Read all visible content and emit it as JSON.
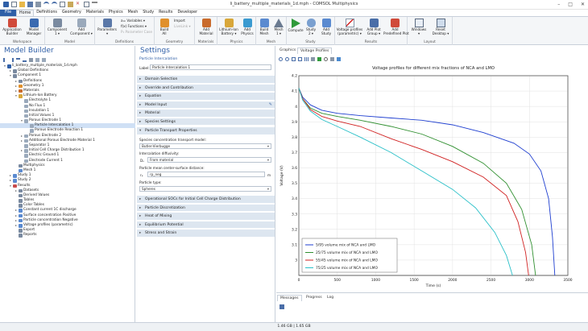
{
  "window": {
    "title": "li_battery_multiple_materials_1d.mph - COMSOL Multiphysics",
    "controls": [
      "–",
      "□",
      "✕"
    ]
  },
  "ribbon_tabs": [
    "File",
    "Home",
    "Definitions",
    "Geometry",
    "Materials",
    "Physics",
    "Mesh",
    "Study",
    "Results",
    "Developer"
  ],
  "ribbon": {
    "workspace": {
      "label": "Workspace",
      "app_builder": "Application\nBuilder",
      "model_manager": "Model\nManager"
    },
    "model": {
      "label": "Model",
      "component": "Component\n1 ▾",
      "add_component": "Add\nComponent ▾"
    },
    "definitions": {
      "label": "Definitions",
      "parameters": "Parameters\n▾",
      "variables": "a= Variables ▾",
      "functions": "f(x) Functions ▾",
      "param_case": "P₁ Parameter Case"
    },
    "geometry": {
      "label": "Geometry",
      "build_all": "Build\nAll",
      "import": "Import",
      "livelink": "LiveLink ▾"
    },
    "materials": {
      "label": "Materials",
      "add_material": "Add\nMaterial"
    },
    "physics": {
      "label": "Physics",
      "lib": "Lithium-Ion\nBattery ▾",
      "add_physics": "Add\nPhysics"
    },
    "mesh": {
      "label": "Mesh",
      "build_mesh": "Build\nMesh",
      "mesh1": "Mesh\n1 ▾"
    },
    "study": {
      "label": "Study",
      "compute": "Compute",
      "study2": "Study\n2 ▾",
      "add_study": "Add\nStudy"
    },
    "results": {
      "label": "Results",
      "voltage_profiles": "Voltage profiles\n(parametric) ▾",
      "add_plot_group": "Add Plot\nGroup ▾",
      "add_predefined": "Add\nPredefined Plot"
    },
    "layout": {
      "label": "Layout",
      "windows": "Windows\n▾",
      "reset_desktop": "Reset\nDesktop ▾"
    }
  },
  "model_builder": {
    "title": "Model Builder",
    "tree": [
      {
        "label": "li_battery_multiple_materials_1d.mph",
        "depth": 0,
        "tog": "▾",
        "color": "#2f5fa7"
      },
      {
        "label": "Global Definitions",
        "depth": 1,
        "tog": "▸",
        "color": "#7a8aa0"
      },
      {
        "label": "Component 1",
        "depth": 1,
        "tog": "▾",
        "color": "#7a8aa0"
      },
      {
        "label": "Definitions",
        "depth": 2,
        "tog": "▸",
        "color": "#7a8aa0"
      },
      {
        "label": "Geometry 1",
        "depth": 2,
        "tog": "▸",
        "color": "#e0902c"
      },
      {
        "label": "Materials",
        "depth": 2,
        "tog": "▸",
        "color": "#c96b2c"
      },
      {
        "label": "Lithium-Ion Battery",
        "depth": 2,
        "tog": "▾",
        "color": "#d8a73a"
      },
      {
        "label": "Electrolyte 1",
        "depth": 3,
        "tog": "",
        "color": "#9aa9bb"
      },
      {
        "label": "No Flux 1",
        "depth": 3,
        "tog": "",
        "color": "#9aa9bb"
      },
      {
        "label": "Insulation 1",
        "depth": 3,
        "tog": "",
        "color": "#9aa9bb"
      },
      {
        "label": "Initial Values 1",
        "depth": 3,
        "tog": "",
        "color": "#9aa9bb"
      },
      {
        "label": "Porous Electrode 1",
        "depth": 3,
        "tog": "▾",
        "color": "#9aa9bb"
      },
      {
        "label": "Particle Intercalation 1",
        "depth": 4,
        "tog": "",
        "color": "#9aa9bb",
        "selected": true
      },
      {
        "label": "Porous Electrode Reaction 1",
        "depth": 4,
        "tog": "",
        "color": "#9aa9bb"
      },
      {
        "label": "Porous Electrode 2",
        "depth": 3,
        "tog": "▸",
        "color": "#9aa9bb"
      },
      {
        "label": "Additional Porous Electrode Material 1",
        "depth": 3,
        "tog": "▸",
        "color": "#9aa9bb"
      },
      {
        "label": "Separator 1",
        "depth": 3,
        "tog": "",
        "color": "#9aa9bb"
      },
      {
        "label": "Initial Cell Charge Distribution 1",
        "depth": 3,
        "tog": "▸",
        "color": "#9aa9bb"
      },
      {
        "label": "Electric Ground 1",
        "depth": 3,
        "tog": "",
        "color": "#9aa9bb"
      },
      {
        "label": "Electrode Current 1",
        "depth": 3,
        "tog": "",
        "color": "#9aa9bb"
      },
      {
        "label": "Multiphysics",
        "depth": 2,
        "tog": "",
        "color": "#7a8aa0"
      },
      {
        "label": "Mesh 1",
        "depth": 2,
        "tog": "",
        "color": "#5a8ad0"
      },
      {
        "label": "Study 1",
        "depth": 1,
        "tog": "▸",
        "color": "#5a8ad0"
      },
      {
        "label": "Study 2",
        "depth": 1,
        "tog": "▸",
        "color": "#5a8ad0"
      },
      {
        "label": "Results",
        "depth": 1,
        "tog": "▾",
        "color": "#c94d4d"
      },
      {
        "label": "Datasets",
        "depth": 2,
        "tog": "▸",
        "color": "#7a8aa0"
      },
      {
        "label": "Derived Values",
        "depth": 2,
        "tog": "",
        "color": "#7a8aa0"
      },
      {
        "label": "Tables",
        "depth": 2,
        "tog": "",
        "color": "#7a8aa0"
      },
      {
        "label": "Color Tables",
        "depth": 2,
        "tog": "",
        "color": "#7a8aa0"
      },
      {
        "label": "Constant current 1C discharge",
        "depth": 2,
        "tog": "▸",
        "color": "#5a8ad0"
      },
      {
        "label": "Surface concentration Positive",
        "depth": 2,
        "tog": "▸",
        "color": "#5a8ad0"
      },
      {
        "label": "Particle concentration Negative",
        "depth": 2,
        "tog": "▸",
        "color": "#5a8ad0"
      },
      {
        "label": "Voltage profiles (parametric)",
        "depth": 2,
        "tog": "▸",
        "color": "#5a8ad0"
      },
      {
        "label": "Export",
        "depth": 2,
        "tog": "",
        "color": "#7a8aa0"
      },
      {
        "label": "Reports",
        "depth": 2,
        "tog": "",
        "color": "#7a8aa0"
      }
    ]
  },
  "settings": {
    "title": "Settings",
    "subtitle": "Particle Intercalation",
    "label_caption": "Label:",
    "label_value": "Particle Intercalation 1",
    "sections_top": [
      "Domain Selection",
      "Override and Contribution",
      "Equation",
      "Model Input",
      "Material",
      "Species Settings"
    ],
    "open_section": "Particle Transport Properties",
    "species_model_caption": "Species concentration transport model:",
    "species_model_value": "Butler-Vierbugge",
    "diffusivity_caption": "Intercalation diffusivity:",
    "diffusivity_symbol": "Dₛ",
    "diffusivity_value": "From material",
    "radius_caption": "Particle mean center-surface distance:",
    "radius_symbol": "rₚ",
    "radius_value": "rp_neg",
    "radius_unit": "m",
    "particle_type_caption": "Particle type:",
    "particle_type_value": "Spheres",
    "sections_bottom": [
      "Operational SOCs for Initial Cell Charge Distribution",
      "Particle Discretization",
      "Heat of Mixing",
      "Equilibrium Potential",
      "Stress and Strain"
    ]
  },
  "graphics": {
    "tabs": [
      "Graphics",
      "Voltage Profiles"
    ],
    "active_tab": 1
  },
  "messages": {
    "tabs": [
      "Messages",
      "Progress",
      "Log"
    ]
  },
  "status_bar": {
    "memory": "1.46 GB | 1.65 GB"
  },
  "chart_data": {
    "type": "line",
    "title": "Voltage profiles for different mix fractions of NCA and LMO",
    "xlabel": "Time (s)",
    "ylabel": "Voltage (V)",
    "xlim": [
      0,
      3500
    ],
    "ylim": [
      2.9,
      4.2
    ],
    "xticks": [
      0,
      500,
      1000,
      1500,
      2000,
      2500,
      3000,
      3500
    ],
    "yticks": [
      3,
      3.1,
      3.2,
      3.3,
      3.4,
      3.5,
      3.6,
      3.7,
      3.8,
      3.9,
      4,
      4.1,
      4.2
    ],
    "grid": true,
    "legend_position": "bottom-left",
    "series": [
      {
        "name": "5/95 volume mix of NCA and LMO",
        "color": "#1f3fd0",
        "points": [
          [
            0,
            4.12
          ],
          [
            50,
            4.06
          ],
          [
            150,
            4.01
          ],
          [
            300,
            3.975
          ],
          [
            500,
            3.955
          ],
          [
            800,
            3.94
          ],
          [
            1200,
            3.925
          ],
          [
            1600,
            3.91
          ],
          [
            2000,
            3.88
          ],
          [
            2400,
            3.83
          ],
          [
            2800,
            3.76
          ],
          [
            3000,
            3.69
          ],
          [
            3150,
            3.58
          ],
          [
            3250,
            3.4
          ],
          [
            3300,
            3.15
          ],
          [
            3330,
            2.9
          ]
        ]
      },
      {
        "name": "25/75 volume mix of NCA and LMO",
        "color": "#2f8f2f",
        "points": [
          [
            0,
            4.12
          ],
          [
            50,
            4.05
          ],
          [
            150,
            3.99
          ],
          [
            300,
            3.955
          ],
          [
            500,
            3.935
          ],
          [
            800,
            3.91
          ],
          [
            1200,
            3.87
          ],
          [
            1600,
            3.82
          ],
          [
            2000,
            3.74
          ],
          [
            2400,
            3.63
          ],
          [
            2700,
            3.5
          ],
          [
            2900,
            3.33
          ],
          [
            3030,
            3.1
          ],
          [
            3080,
            2.9
          ]
        ]
      },
      {
        "name": "55/45 volume mix of NCA and LMO",
        "color": "#d02020",
        "points": [
          [
            0,
            4.12
          ],
          [
            50,
            4.05
          ],
          [
            150,
            3.98
          ],
          [
            300,
            3.935
          ],
          [
            500,
            3.905
          ],
          [
            800,
            3.87
          ],
          [
            1200,
            3.79
          ],
          [
            1600,
            3.72
          ],
          [
            2000,
            3.64
          ],
          [
            2400,
            3.54
          ],
          [
            2700,
            3.42
          ],
          [
            2850,
            3.25
          ],
          [
            2950,
            3.05
          ],
          [
            2990,
            2.9
          ]
        ]
      },
      {
        "name": "75/25 volume mix of NCA and LMO",
        "color": "#2ac0c8",
        "points": [
          [
            0,
            4.12
          ],
          [
            50,
            4.04
          ],
          [
            150,
            3.97
          ],
          [
            300,
            3.915
          ],
          [
            500,
            3.87
          ],
          [
            800,
            3.8
          ],
          [
            1200,
            3.7
          ],
          [
            1600,
            3.58
          ],
          [
            2000,
            3.46
          ],
          [
            2300,
            3.34
          ],
          [
            2550,
            3.18
          ],
          [
            2700,
            3.03
          ],
          [
            2780,
            2.9
          ]
        ]
      }
    ]
  }
}
